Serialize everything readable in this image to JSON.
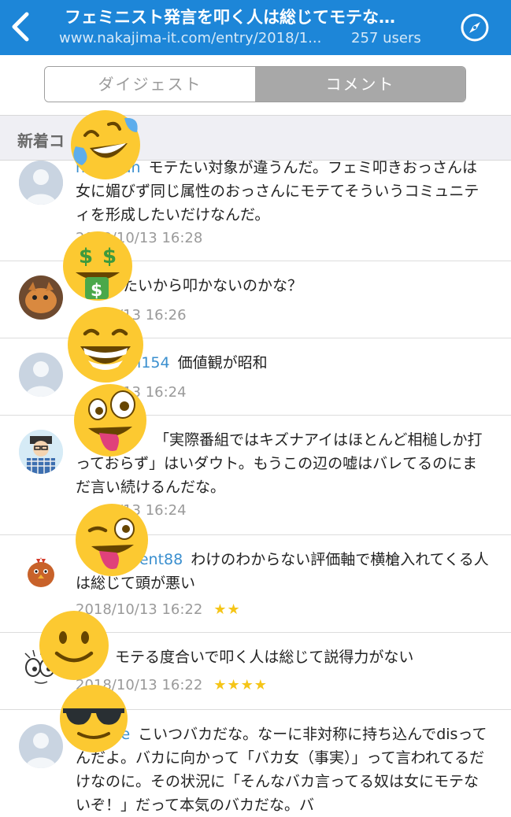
{
  "header": {
    "title": "フェミニスト発言を叩く人は総じてモテな…",
    "url": "www.nakajima-it.com/entry/2018/1...",
    "users": "257 users"
  },
  "tabs": {
    "digest": "ダイジェスト",
    "comment": "コメント"
  },
  "section": {
    "title": "新着コ"
  },
  "comments": [
    {
      "user": "hirochan",
      "text": "モテたい対象が違うんだ。フェミ叩きおっさんは女に媚びず同じ属性のおっさんにモテてそういうコミュニティを形成したいだけなんだ。",
      "date": "2018/10/13 16:28",
      "stars": ""
    },
    {
      "user": "n",
      "text": "モテたいから叩かないのかな？",
      "date": "/13 16:26",
      "stars": ""
    },
    {
      "user": "hi154",
      "text": "価値観が昭和",
      "date": "/13 16:24",
      "stars": ""
    },
    {
      "user": "",
      "text": "「実際番組ではキズナアイはほとんど相槌しか打っておらず」はいダウト。もうこの辺の嘘はバレてるのにまだ言い続けるんだな。",
      "date": "/13 16:24",
      "stars": ""
    },
    {
      "user": "rrent88",
      "text": "わけのわからない評価軸で横槍入れてくる人は総じて頭が悪い",
      "date": "2018/10/13 16:22",
      "stars": "★★"
    },
    {
      "user": "",
      "text": "モテる度合いで叩く人は総じて説得力がない",
      "date": "2018/10/13 16:22",
      "stars": "★★★★"
    },
    {
      "user": "te",
      "text": "こいつバカだな。なーに非対称に持ち込んでdisってんだよ。バカに向かって「バカ女（事実）」って言われてるだけなのに。その状況に「そんなバカ言ってる奴は女にモテないぞ！」だって本気のバカだな。バ",
      "date": "",
      "stars": ""
    }
  ],
  "colors": {
    "header_bg": "#1d86d8",
    "username": "#3a8fcf",
    "star": "#f5c518"
  },
  "icons": [
    "back-chevron-icon",
    "compass-icon",
    "rofl-emoji",
    "money-mouth-emoji",
    "grin-emoji",
    "zany-emoji",
    "wink-tongue-emoji",
    "smile-emoji",
    "sunglasses-emoji"
  ]
}
